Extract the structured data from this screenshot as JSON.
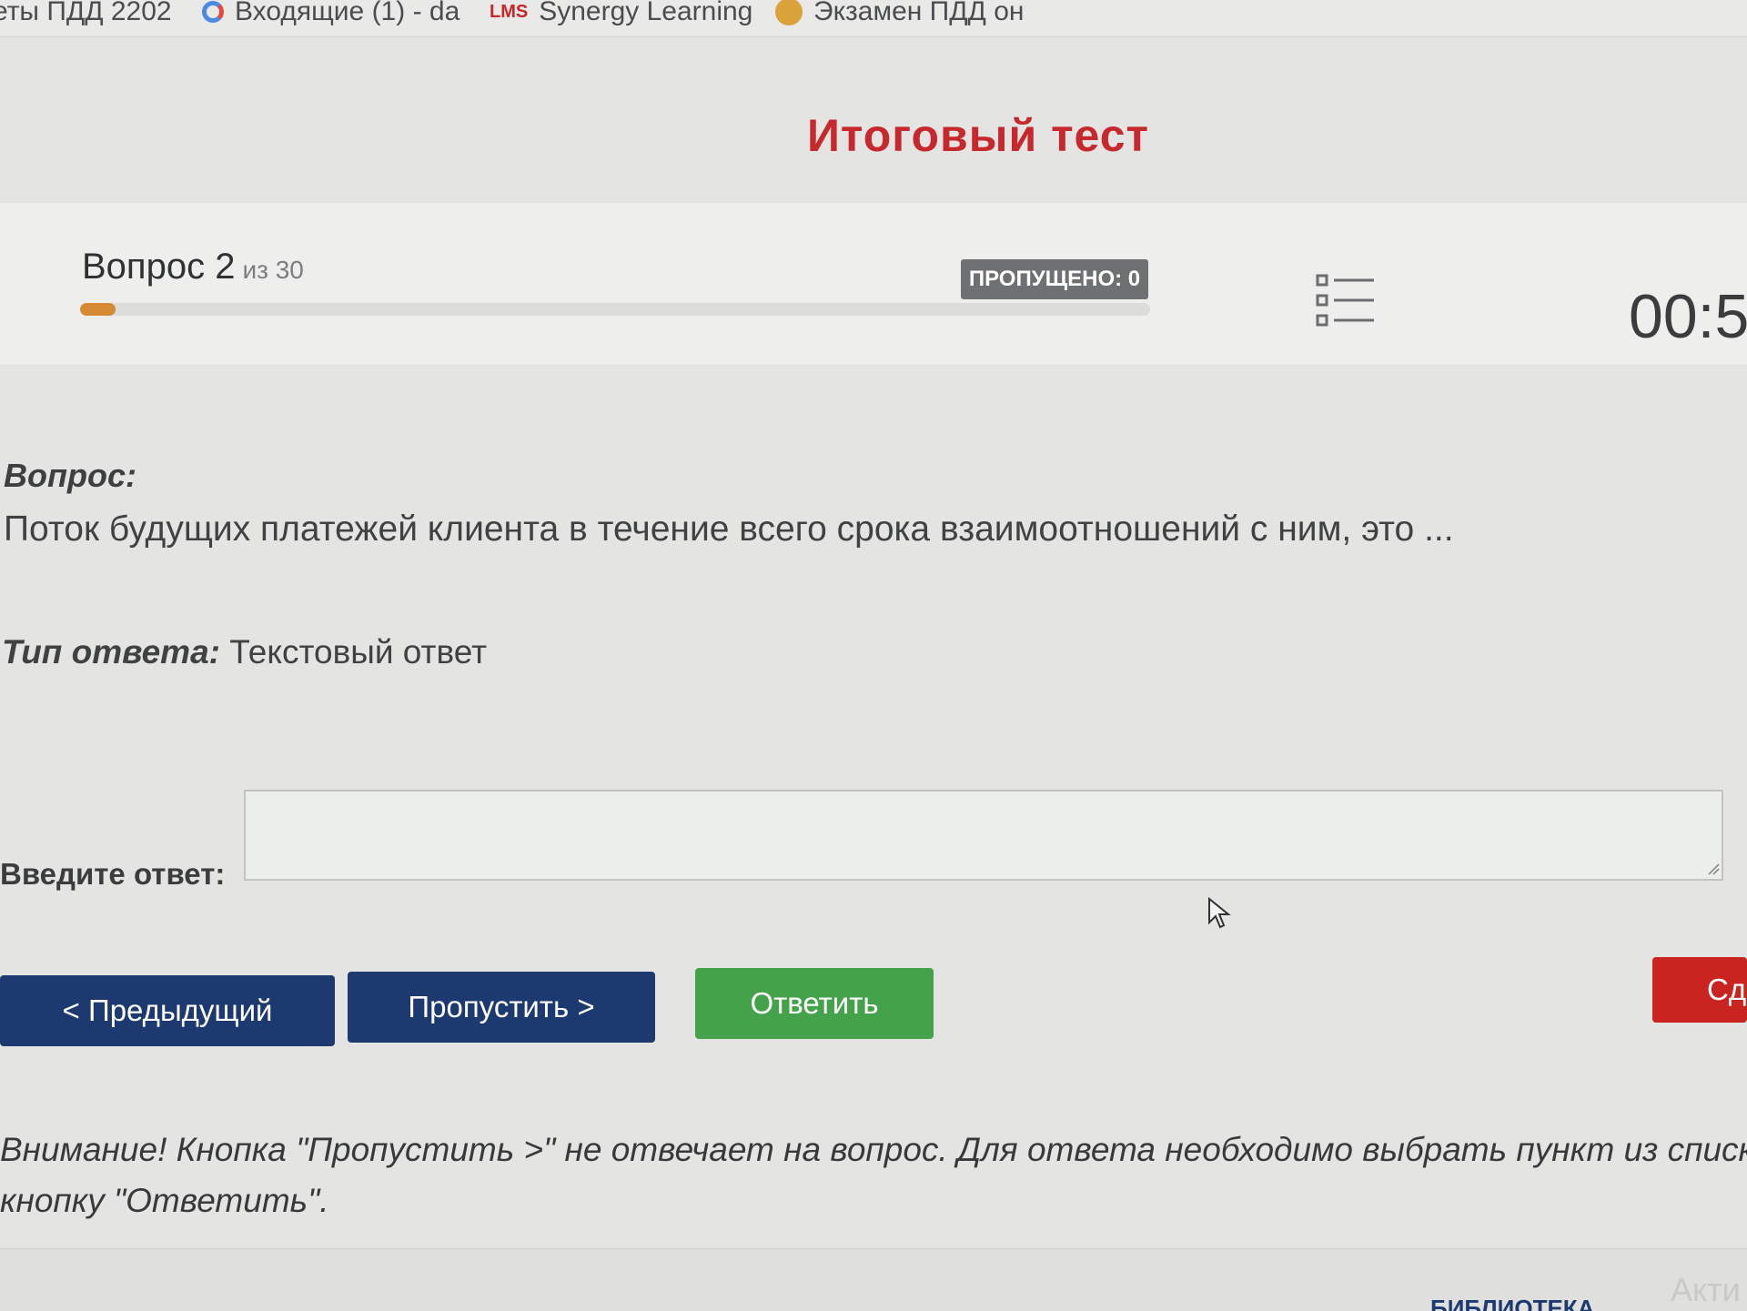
{
  "bookmarks": {
    "items": [
      {
        "label": "еты ПДД 2202"
      },
      {
        "label": "Входящие (1) - da"
      },
      {
        "label": "Synergy Learning",
        "badge": "LMS"
      },
      {
        "label": "Экзамен ПДД он"
      }
    ]
  },
  "page": {
    "title": "Итоговый тест"
  },
  "question_header": {
    "label": "Вопрос 2",
    "of_total": "из 30",
    "progress_fraction": 0.0333,
    "skipped_badge": "ПРОПУЩЕНО: 0",
    "timer": "00:5"
  },
  "question": {
    "label": "Вопрос:",
    "text": "Поток будущих платежей клиента в течение всего срока взаимоотношений с ним, это ..."
  },
  "answer_type": {
    "label": "Тип ответа:",
    "value": "Текстовый ответ"
  },
  "answer": {
    "label": "Введите ответ:",
    "value": ""
  },
  "buttons": {
    "previous": "< Предыдущий",
    "skip": "Пропустить >",
    "answer": "Ответить",
    "submit": "Сда"
  },
  "warning": {
    "line1": "Внимание! Кнопка \"Пропустить >\" не отвечает на вопрос. Для ответа необходимо выбрать пункт из списка и на",
    "line2": "кнопку \"Ответить\"."
  },
  "footer": {
    "link": "БИБЛИОТЕКА",
    "faint": "Акти"
  },
  "colors": {
    "title_red": "#c7282d",
    "button_blue": "#1c3a6f",
    "button_green": "#44a34a",
    "button_red": "#c9241f",
    "progress_orange": "#d58a33",
    "badge_gray": "#6e7072"
  },
  "icons": [
    "google-icon",
    "lms-icon",
    "exam-icon",
    "question-list-icon",
    "mouse-cursor-icon"
  ]
}
